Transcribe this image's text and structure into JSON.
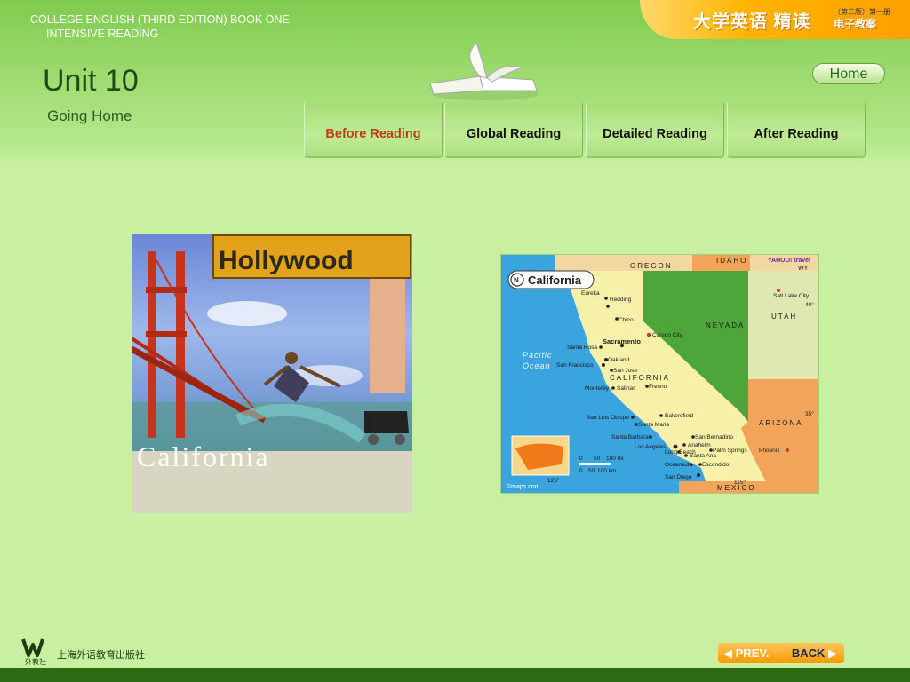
{
  "header": {
    "book_title_line1": "COLLEGE ENGLISH (THIRD EDITION)   BOOK  ONE",
    "book_title_line2": "INTENSIVE READING",
    "cn_title": "大学英语 精读",
    "cn_edition": "（第三版）第一册",
    "cn_subtitle": "电子教案",
    "unit_title": "Unit 10",
    "unit_subtitle": "Going Home",
    "home_label": "Home"
  },
  "tabs": [
    {
      "label": "Before Reading",
      "active": true
    },
    {
      "label": "Global Reading",
      "active": false
    },
    {
      "label": "Detailed Reading",
      "active": false
    },
    {
      "label": "After Reading",
      "active": false
    }
  ],
  "photo": {
    "sign_text": "Hollywood",
    "caption": "California"
  },
  "map": {
    "title": "California",
    "brand": "YAHOO! travel",
    "credit": "©maps.com",
    "states": [
      "OREGON",
      "IDAHO",
      "NEVADA",
      "UTAH",
      "ARIZONA",
      "MEXICO",
      "CALIFORNIA",
      "WY"
    ],
    "ocean": [
      "Pacific",
      "Ocean"
    ],
    "cities": [
      "Eureka",
      "Redding",
      "Chico",
      "Sacramento",
      "Carson City",
      "Santa Rosa",
      "Oakland",
      "San Francisco",
      "San Jose",
      "Fresno",
      "Monterey",
      "Salinas",
      "San Luis Obispo",
      "Bakersfield",
      "Santa Maria",
      "Santa Barbara",
      "Los Angeles",
      "San Bernadino",
      "Anaheim",
      "Palm Springs",
      "Long Beach",
      "Santa Ana",
      "Oceanside",
      "Escondido",
      "San Diego",
      "Salt Lake City",
      "Phoenix"
    ],
    "scale": [
      "0",
      "50",
      "100 mi",
      "0",
      "50",
      "100 km"
    ],
    "coords": [
      "40°",
      "35°",
      "115°",
      "125°"
    ]
  },
  "footer": {
    "publisher": "上海外语教育出版社",
    "logo_text": "外教社",
    "prev_label": "PREV.",
    "back_label": "BACK"
  },
  "colors": {
    "background": "#c9efa0",
    "active_tab": "#c43a12",
    "accent_orange": "#ffa000",
    "footer_bar": "#2e6a12"
  }
}
